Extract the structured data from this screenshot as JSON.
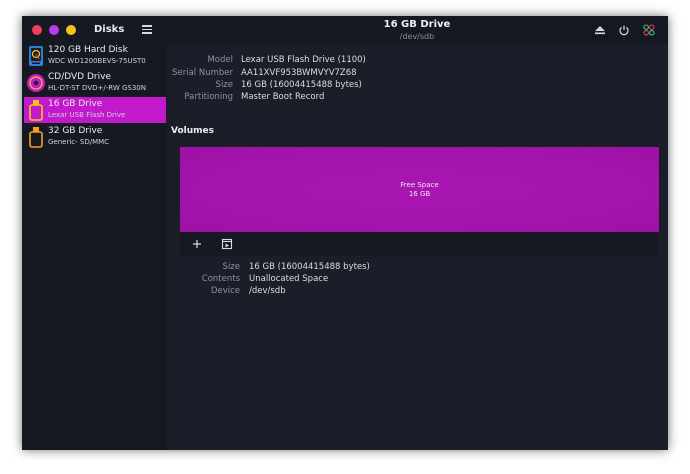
{
  "app": {
    "title": "Disks",
    "menu_icon": "hamburger-menu-icon"
  },
  "header": {
    "title": "16 GB Drive",
    "subtitle": "/dev/sdb",
    "actions": [
      "eject-icon",
      "power-icon",
      "drive-settings-icon"
    ]
  },
  "sidebar": {
    "items": [
      {
        "name": "120 GB Hard Disk",
        "model": "WDC WD1200BEVS-75UST0",
        "icon": "hard-disk-icon",
        "selected": false
      },
      {
        "name": "CD/DVD Drive",
        "model": "HL-DT-ST DVD+/-RW GS30N",
        "icon": "optical-disc-icon",
        "selected": false
      },
      {
        "name": "16 GB Drive",
        "model": "Lexar USB Flash Drive",
        "icon": "usb-drive-icon",
        "selected": true
      },
      {
        "name": "32 GB Drive",
        "model": "Generic- SD/MMC",
        "icon": "usb-drive-icon",
        "selected": false
      }
    ]
  },
  "drive_info": {
    "model_label": "Model",
    "model": "Lexar USB Flash Drive (1100)",
    "serial_label": "Serial Number",
    "serial": "AA11XVF953BWMVYV7Z68",
    "size_label": "Size",
    "size": "16 GB (16004415488 bytes)",
    "partitioning_label": "Partitioning",
    "partitioning": "Master Boot Record"
  },
  "volumes": {
    "heading": "Volumes",
    "bar_label": "Free Space",
    "bar_size": "16 GB",
    "toolbar": [
      "add-partition-icon",
      "partition-options-icon"
    ]
  },
  "volume_info": {
    "size_label": "Size",
    "size": "16 GB (16004415488 bytes)",
    "contents_label": "Contents",
    "contents": "Unallocated Space",
    "device_label": "Device",
    "device": "/dev/sdb"
  },
  "colors": {
    "accent": "#c219cc",
    "volume_fill": "#a414ad",
    "window_bg": "#1b1e29",
    "sidebar_bg": "#161922"
  }
}
